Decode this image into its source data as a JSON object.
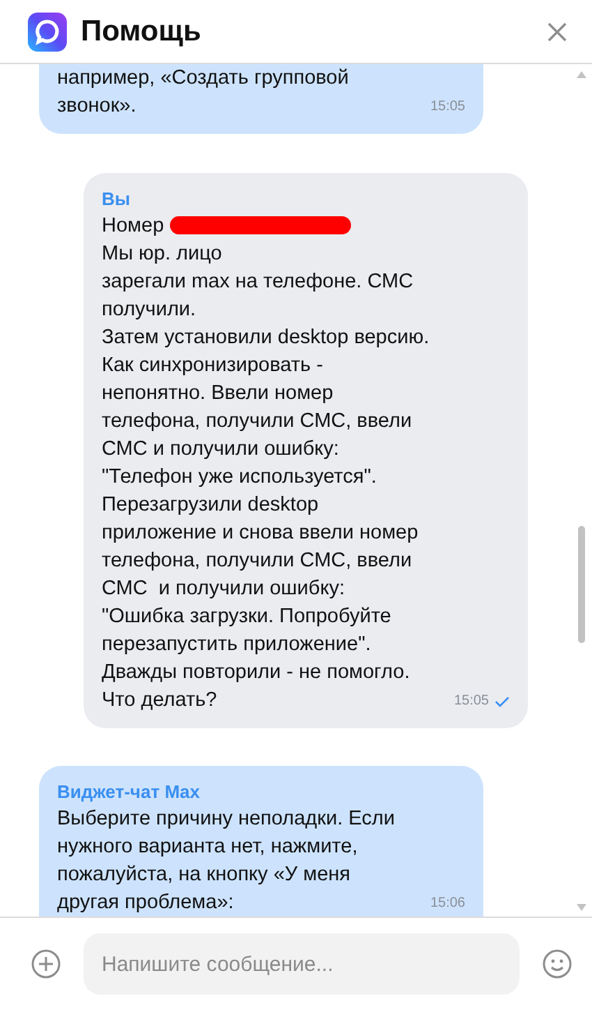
{
  "header": {
    "title": "Помощь"
  },
  "messages": [
    {
      "kind": "incoming",
      "text": "например, «Создать групповой\nзвонок».",
      "time": "15:05"
    },
    {
      "kind": "outgoing",
      "sender": "Вы",
      "first_line": {
        "text": "Номер",
        "redacted": true
      },
      "text": "Мы юр. лицо\nзарегали max на телефоне. СМС\nполучили.\nЗатем установили desktop версию.\nКак синхронизировать -\nнепонятно. Ввели номер\nтелефона, получили СМС, ввели\nСМС и получили ошибку:\n\"Телефон уже используется\".\nПерезагрузили desktop\nприложение и снова ввели номер\nтелефона, получили СМС, ввели\nСМС  и получили ошибку:\n\"Ошибка загрузки. Попробуйте\nперезапустить приложение\".\nДважды повторили - не помогло.\nЧто делать?",
      "time": "15:05",
      "delivered": true
    },
    {
      "kind": "incoming",
      "sender": "Виджет-чат Max",
      "text": "Выберите причину неполадки. Если\nнужного варианта нет, нажмите,\nпожалуйста, на кнопку «У меня\nдругая проблема»:",
      "time": "15:06"
    }
  ],
  "composer": {
    "placeholder": "Напишите сообщение..."
  }
}
